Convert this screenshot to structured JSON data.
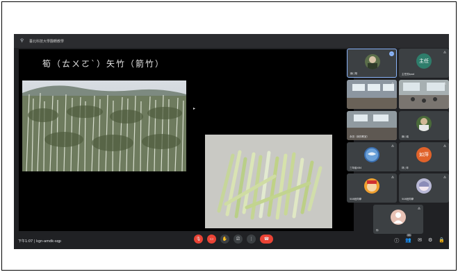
{
  "window": {
    "title": "臺北科技大學翻轉教學"
  },
  "slide": {
    "title": "筍（ㄊㄨㄛˋ）矢竹（箭竹）"
  },
  "participants": [
    {
      "name": "趙○翔",
      "kind": "photo",
      "active": true,
      "badge": "",
      "avatar_color": "#5b6e4a"
    },
    {
      "name": "主任的Ipad",
      "kind": "initial",
      "initial": "主任",
      "avatar_color": "#2e7d6b"
    },
    {
      "name": "",
      "kind": "classroom"
    },
    {
      "name": "",
      "kind": "classroom"
    },
    {
      "name": "永田（我的教室）",
      "kind": "classroom"
    },
    {
      "name": "趙○強",
      "kind": "photo",
      "avatar_color": "#4a6a3a"
    },
    {
      "name": "三年級484",
      "kind": "globe",
      "avatar_color": "#3b6fb0"
    },
    {
      "name": "林○年",
      "kind": "initial",
      "initial": "如萍",
      "avatar_color": "#e0622a"
    },
    {
      "name": "508班同學",
      "kind": "cartoon",
      "avatar_color": "#f0a030"
    },
    {
      "name": "508班同學",
      "kind": "anime",
      "avatar_color": "#b9b9d6"
    },
    {
      "name": "你",
      "kind": "self",
      "avatar_color": "#e8c2b5"
    }
  ],
  "meeting": {
    "time": "下午1:07",
    "separator": "|",
    "code": "kgn-amdk-sqp"
  },
  "controls": {
    "mic_icon": "mic-off-icon",
    "camera_icon": "camera-off-icon",
    "hand_icon": "raise-hand-icon",
    "present_icon": "present-icon",
    "more_icon": "more-vert-icon",
    "end_icon": "end-call-icon"
  },
  "right_tools": {
    "info_label": "ⓘ",
    "people_label": "👥",
    "people_count": "11",
    "chat_label": "✉",
    "activities_label": "⚙",
    "lock_label": "🔒"
  },
  "colors": {
    "meet_bg": "#202124",
    "tile_bg": "#3c4043",
    "end_red": "#ea4335",
    "active_border": "#8ab4f8"
  }
}
